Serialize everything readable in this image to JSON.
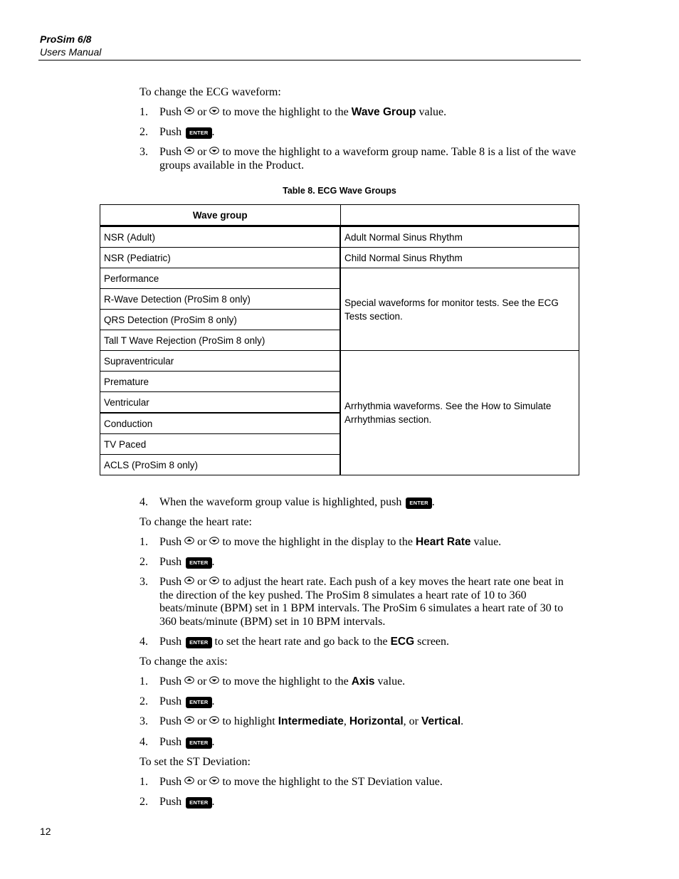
{
  "header": {
    "title": "ProSim 6/8",
    "subtitle": "Users Manual"
  },
  "icons": {
    "up_key": "up-arrow-key-icon",
    "down_key": "down-arrow-key-icon",
    "enter_key_label": "ENTER"
  },
  "section_waveform": {
    "intro": "To change the ECG waveform:",
    "steps": [
      {
        "num": "1.",
        "pre": "Push",
        "or": "or",
        "mid": "to move the highlight to the",
        "bold": "Wave Group",
        "post": "value."
      },
      {
        "num": "2.",
        "pre": "Push",
        "post": "."
      },
      {
        "num": "3.",
        "pre": "Push",
        "or": "or",
        "post": "to move the highlight to a waveform group name. Table 8 is a list of the wave groups available in the Product."
      },
      {
        "num": "4.",
        "pre": "When the waveform group value is highlighted, push",
        "post": "."
      }
    ]
  },
  "table": {
    "caption": "Table 8. ECG Wave Groups",
    "headers": [
      "Wave group",
      ""
    ],
    "rows": [
      {
        "group": "NSR (Adult)",
        "description": "Adult Normal Sinus Rhythm"
      },
      {
        "group": "NSR (Pediatric)",
        "description": "Child Normal Sinus Rhythm"
      },
      {
        "group": "Performance",
        "description": "Special waveforms for monitor tests. See the ECG Tests section."
      },
      {
        "group": "R-Wave Detection (ProSim 8 only)",
        "description": ""
      },
      {
        "group": "QRS Detection (ProSim 8 only)",
        "description": ""
      },
      {
        "group": "Tall T Wave Rejection (ProSim 8 only)",
        "description": ""
      },
      {
        "group": "Supraventricular",
        "description": "Arrhythmia waveforms. See the How to Simulate Arrhythmias section."
      },
      {
        "group": "Premature",
        "description": ""
      },
      {
        "group": "Ventricular",
        "description": ""
      },
      {
        "group": "Conduction",
        "description": ""
      },
      {
        "group": "TV Paced",
        "description": ""
      },
      {
        "group": "ACLS (ProSim 8 only)",
        "description": ""
      }
    ]
  },
  "section_heart_rate": {
    "intro": "To change the heart rate:",
    "steps": [
      {
        "num": "1.",
        "pre": "Push",
        "or": "or",
        "mid": "to move the highlight in the display to the",
        "bold": "Heart Rate",
        "post": "value."
      },
      {
        "num": "2.",
        "pre": "Push",
        "post": "."
      },
      {
        "num": "3.",
        "pre": "Push",
        "or": "or",
        "post": "to adjust the heart rate. Each push of a key moves the heart rate one beat in the direction of the key pushed. The ProSim 8 simulates a heart rate of 10 to 360 beats/minute (BPM) set in 1 BPM intervals. The ProSim 6 simulates a heart rate of 30 to 360 beats/minute (BPM) set in 10 BPM intervals."
      },
      {
        "num": "4.",
        "pre": "Push",
        "mid": "to set the heart rate and go back to the",
        "bold": "ECG",
        "post": "screen."
      }
    ]
  },
  "section_axis": {
    "intro": "To change the axis:",
    "steps": [
      {
        "num": "1.",
        "pre": "Push",
        "or": "or",
        "mid": "to move the highlight to the",
        "bold": "Axis",
        "post": "value."
      },
      {
        "num": "2.",
        "pre": "Push",
        "post": "."
      },
      {
        "num": "3.",
        "pre": "Push",
        "or": "or",
        "mid": "to highlight",
        "bold1": "Intermediate",
        "sep1": ",",
        "bold2": "Horizontal",
        "sep2": ", or",
        "bold3": "Vertical",
        "post": "."
      },
      {
        "num": "4.",
        "pre": "Push",
        "post": "."
      }
    ]
  },
  "section_st": {
    "intro": "To set the ST Deviation:",
    "steps": [
      {
        "num": "1.",
        "pre": "Push",
        "or": "or",
        "post": "to move the highlight to the ST Deviation value."
      },
      {
        "num": "2.",
        "pre": "Push",
        "post": "."
      }
    ]
  },
  "footer": {
    "page_number": "12"
  }
}
